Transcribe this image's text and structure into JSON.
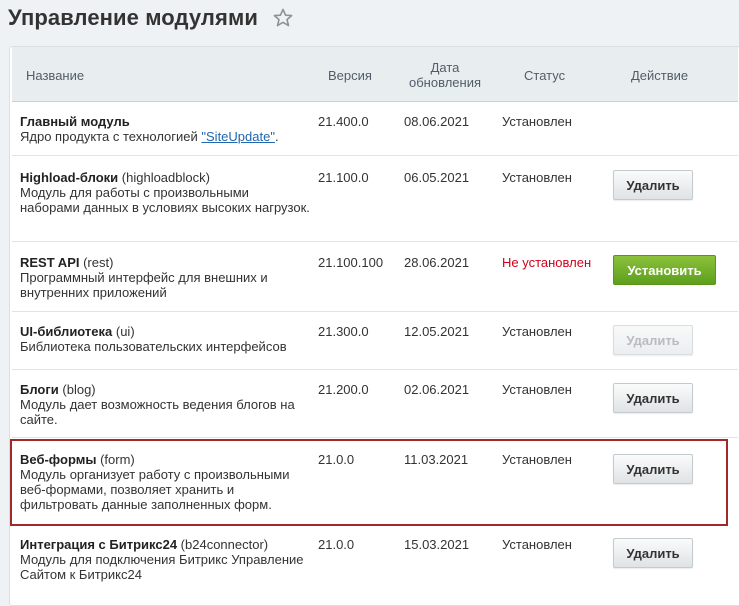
{
  "page": {
    "title": "Управление модулями"
  },
  "table": {
    "headers": {
      "name": "Название",
      "version": "Версия",
      "date_line1": "Дата",
      "date_line2": "обновления",
      "status": "Статус",
      "action": "Действие"
    },
    "rows": [
      {
        "name": "Главный модуль",
        "code": "",
        "desc": "Ядро продукта с технологией ",
        "desc_link": "\"SiteUpdate\"",
        "desc_after": ".",
        "version": "21.400.0",
        "date": "08.06.2021",
        "status": "Установлен",
        "action": ""
      },
      {
        "name": "Highload-блоки",
        "code": " (highloadblock)",
        "desc": "Модуль для работы с произвольными наборами данных в условиях высоких нагрузок.",
        "version": "21.100.0",
        "date": "06.05.2021",
        "status": "Установлен",
        "action": "Удалить"
      },
      {
        "name": "REST API",
        "code": " (rest)",
        "desc": "Программный интерфейс для внешних и внутренних приложений",
        "version": "21.100.100",
        "date": "28.06.2021",
        "status": "Не установлен",
        "action": "Установить"
      },
      {
        "name": "UI-библиотека",
        "code": " (ui)",
        "desc": "Библиотека пользовательских интерфейсов",
        "version": "21.300.0",
        "date": "12.05.2021",
        "status": "Установлен",
        "action": "Удалить"
      },
      {
        "name": "Блоги",
        "code": " (blog)",
        "desc": "Модуль дает возможность ведения блогов на сайте.",
        "version": "21.200.0",
        "date": "02.06.2021",
        "status": "Установлен",
        "action": "Удалить"
      },
      {
        "name": "Веб-формы",
        "code": " (form)",
        "desc": "Модуль организует работу с произвольными веб-формами, позволяет хранить и фильтровать данные заполненных форм.",
        "version": "21.0.0",
        "date": "11.03.2021",
        "status": "Установлен",
        "action": "Удалить"
      },
      {
        "name": "Интеграция с Битрикс24",
        "code": " (b24connector)",
        "desc": "Модуль для подключения Битрикс Управление Сайтом к Битрикс24",
        "version": "21.0.0",
        "date": "15.03.2021",
        "status": "Установлен",
        "action": "Удалить"
      }
    ]
  },
  "colors": {
    "status_not_installed": "#d0021b",
    "install_button": "#7cb82f",
    "highlight_border": "#a02a2a",
    "link": "#2067b0"
  },
  "icons": {
    "favorite": "star-icon"
  }
}
